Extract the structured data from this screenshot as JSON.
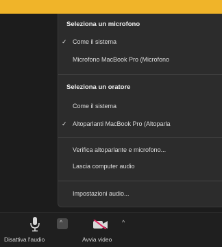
{
  "menu": {
    "mic_header": "Seleziona un microfono",
    "mic_items": [
      {
        "label": "Come il sistema",
        "checked": true
      },
      {
        "label": "Microfono MacBook Pro (Microfono",
        "checked": false
      }
    ],
    "speaker_header": "Seleziona un oratore",
    "speaker_items": [
      {
        "label": "Come il sistema",
        "checked": false
      },
      {
        "label": "Altoparlanti MacBook Pro (Altoparla",
        "checked": true
      }
    ],
    "actions": [
      "Verifica altoparlante e microfono...",
      "Lascia computer audio"
    ],
    "settings": "Impostazioni audio...",
    "check_mark": "✓"
  },
  "toolbar": {
    "mute_label": "Disattiva l'audio",
    "video_label": "Avvia video",
    "caret": "^"
  },
  "colors": {
    "top_bar": "#f0b429",
    "menu_bg": "#2c2c2c",
    "video_off": "#e0245e"
  }
}
